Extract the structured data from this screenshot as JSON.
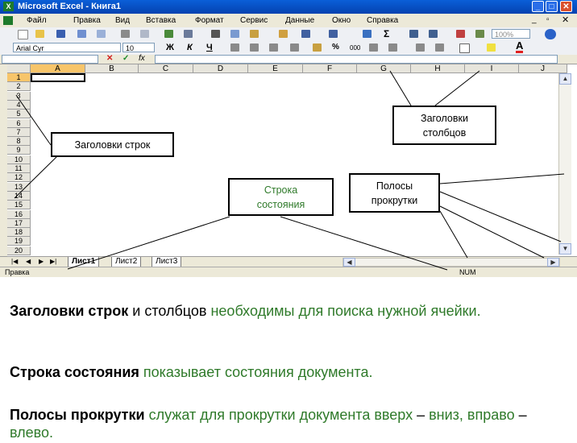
{
  "window": {
    "title": "Microsoft Excel - Книга1"
  },
  "menu": [
    "Файл",
    "Правка",
    "Вид",
    "Вставка",
    "Формат",
    "Сервис",
    "Данные",
    "Окно",
    "Справка"
  ],
  "toolbar": {
    "zoom": "100%",
    "font": "Arial Cyr",
    "size": "10",
    "bold": "Ж",
    "italic": "К",
    "underline": "Ч",
    "pct": "%",
    "thousands": "000"
  },
  "formula": {
    "cancel": "✕",
    "enter": "✓",
    "fx": "fx"
  },
  "columns": [
    "A",
    "B",
    "C",
    "D",
    "E",
    "F",
    "G",
    "H",
    "I",
    "J"
  ],
  "rows": [
    "1",
    "2",
    "3",
    "4",
    "5",
    "6",
    "7",
    "8",
    "9",
    "10",
    "11",
    "12",
    "13",
    "14",
    "15",
    "16",
    "17",
    "18",
    "19",
    "20"
  ],
  "sheets": [
    "Лист1",
    "Лист2",
    "Лист3"
  ],
  "status": {
    "left": "Правка",
    "num": "NUM"
  },
  "callouts": {
    "row_headers": "Заголовки строк",
    "col_headers_1": "Заголовки",
    "col_headers_2": "столбцов",
    "status_1": "Строка",
    "status_2": "состояния",
    "scroll_1": "Полосы",
    "scroll_2": "прокрутки"
  },
  "explanations": {
    "p1_bold": "Заголовки строк",
    "p1_plain": " и столбцов ",
    "p1_green": "необходимы для поиска нужной ячейки.",
    "p2_bold": "Строка состояния",
    "p2_green": " показывает состояния документа.",
    "p3_bold": "Полосы прокрутки",
    "p3_green1": " служат для прокрутки документа вверх ",
    "p3_dash1": "– ",
    "p3_green2": "вниз, вправо ",
    "p3_dash2": "– ",
    "p3_green3": "влево."
  },
  "colors": {
    "accent": "#0a5fd8",
    "highlight": "#f7c56a",
    "green": "#2f7a2a"
  }
}
